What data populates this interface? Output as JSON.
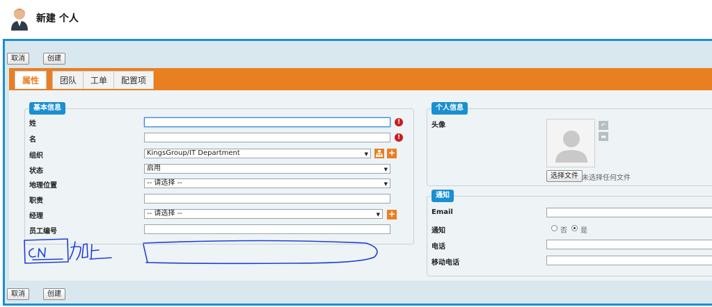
{
  "page": {
    "title": "新建 个人",
    "avatar_icon": "person-avatar-icon"
  },
  "toolbar": {
    "cancel": "取消",
    "create": "创建"
  },
  "tabs": [
    {
      "label": "属性",
      "active": true
    },
    {
      "label": "团队",
      "active": false
    },
    {
      "label": "工单",
      "active": false
    },
    {
      "label": "配置项",
      "active": false
    }
  ],
  "basic_info": {
    "legend": "基本信息",
    "fields": {
      "last_name": {
        "label": "姓",
        "value": ""
      },
      "first_name": {
        "label": "名",
        "value": ""
      },
      "org": {
        "label": "组织",
        "value": "KingsGroup/IT Department"
      },
      "status": {
        "label": "状态",
        "value": "启用"
      },
      "location": {
        "label": "地理位置",
        "value": "-- 请选择 --"
      },
      "job": {
        "label": "职责",
        "value": ""
      },
      "manager": {
        "label": "经理",
        "value": "-- 请选择 --"
      },
      "employee_no": {
        "label": "员工编号",
        "value": ""
      }
    }
  },
  "personal_info": {
    "legend": "个人信息",
    "photo_label": "头像",
    "choose_file": "选择文件",
    "no_file": "未选择任何文件"
  },
  "notify": {
    "legend": "通知",
    "email_label": "Email",
    "email_value": "",
    "notify_label": "通知",
    "options": {
      "no": "否",
      "yes": "是"
    },
    "selected": "是",
    "phone_label": "电话",
    "phone_value": "",
    "mobile_label": "移动电话",
    "mobile_value": ""
  },
  "annotation": {
    "text": "CN 加上"
  },
  "colors": {
    "accent": "#ea7f21",
    "frame": "#1a8fd1",
    "error": "#c81e1e"
  }
}
